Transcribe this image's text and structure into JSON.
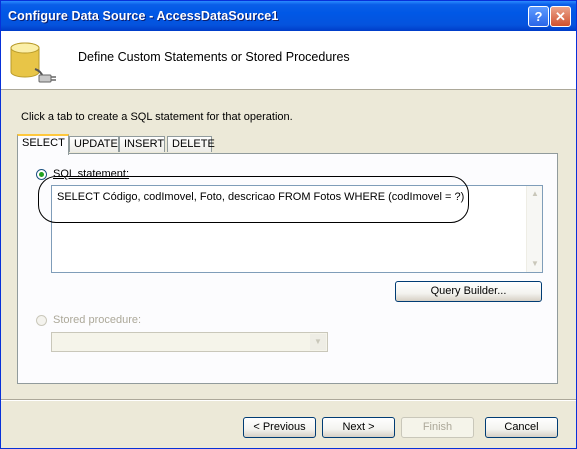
{
  "window": {
    "title": "Configure Data Source - AccessDataSource1",
    "help_label": "?",
    "close_label": "✕"
  },
  "header": {
    "title": "Define Custom Statements or Stored Procedures",
    "icon": "database-connector-icon"
  },
  "instruction": "Click a tab to create a SQL statement for that operation.",
  "tabs": [
    {
      "label": "SELECT",
      "active": true
    },
    {
      "label": "UPDATE",
      "active": false
    },
    {
      "label": "INSERT",
      "active": false
    },
    {
      "label": "DELETE",
      "active": false
    }
  ],
  "sql_statement": {
    "label": "SQL statement:",
    "selected": true,
    "value": "SELECT Código, codImovel, Foto, descricao FROM Fotos WHERE (codImovel = ?)"
  },
  "query_builder_label": "Query Builder...",
  "stored_procedure": {
    "label": "Stored procedure:",
    "selected": false,
    "value": ""
  },
  "buttons": {
    "previous": "< Previous",
    "next": "Next >",
    "finish": "Finish",
    "cancel": "Cancel"
  },
  "colors": {
    "title_bar": "#0058E6",
    "dialog_bg": "#ECE9D8",
    "active_tab_accent": "#FFC83C"
  }
}
